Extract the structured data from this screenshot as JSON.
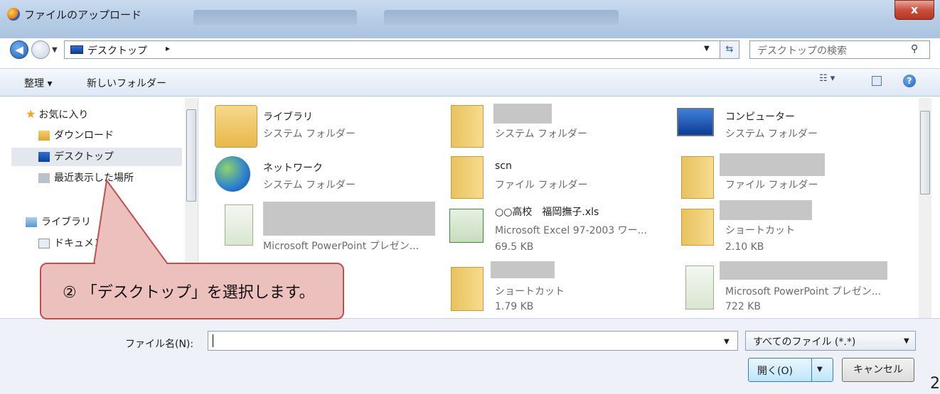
{
  "window": {
    "title": "ファイルのアップロード",
    "close_glyph": "x"
  },
  "address": {
    "location": "デスクトップ",
    "separator": "▸",
    "search_placeholder": "デスクトップの検索"
  },
  "toolbar": {
    "organize": "整理 ▾",
    "new_folder": "新しいフォルダー"
  },
  "sidebar": {
    "favorites": "お気に入り",
    "items": [
      {
        "label": "ダウンロード"
      },
      {
        "label": "デスクトップ",
        "selected": true
      },
      {
        "label": "最近表示した場所"
      }
    ],
    "libraries": "ライブラリ",
    "documents": "ドキュメント"
  },
  "files": [
    {
      "name": "ライブラリ",
      "line2": "システム フォルダー",
      "line3": ""
    },
    {
      "name": "",
      "line2": "システム フォルダー",
      "line3": ""
    },
    {
      "name": "コンピューター",
      "line2": "システム フォルダー",
      "line3": ""
    },
    {
      "name": "ネットワーク",
      "line2": "システム フォルダー",
      "line3": ""
    },
    {
      "name": "scn",
      "line2": "ファイル フォルダー",
      "line3": ""
    },
    {
      "name": "",
      "line2": "ファイル フォルダー",
      "line3": ""
    },
    {
      "name": "",
      "line2": "Microsoft PowerPoint プレゼン...",
      "line3": ""
    },
    {
      "name": "○○高校　福岡撫子.xls",
      "line2": "Microsoft Excel 97-2003 ワー...",
      "line3": "69.5 KB"
    },
    {
      "name": "",
      "line2": "ショートカット",
      "line3": "2.10 KB"
    },
    {
      "name": "",
      "line2": "ショートカット",
      "line3": "1.79 KB"
    },
    {
      "name": "",
      "line2": "Microsoft PowerPoint プレゼン...",
      "line3": "722 KB"
    }
  ],
  "footer": {
    "filename_label": "ファイル名(N):",
    "filename_value": "",
    "filter": "すべてのファイル (*.*)",
    "open": "開く(O)",
    "cancel": "キャンセル",
    "edge_char": "2"
  },
  "callout": {
    "text": "② 「デスクトップ」を選択します。"
  },
  "colors": {
    "callout_fill": "#ebc0bd",
    "callout_border": "#c05050",
    "selection": "#e3e8ef"
  }
}
